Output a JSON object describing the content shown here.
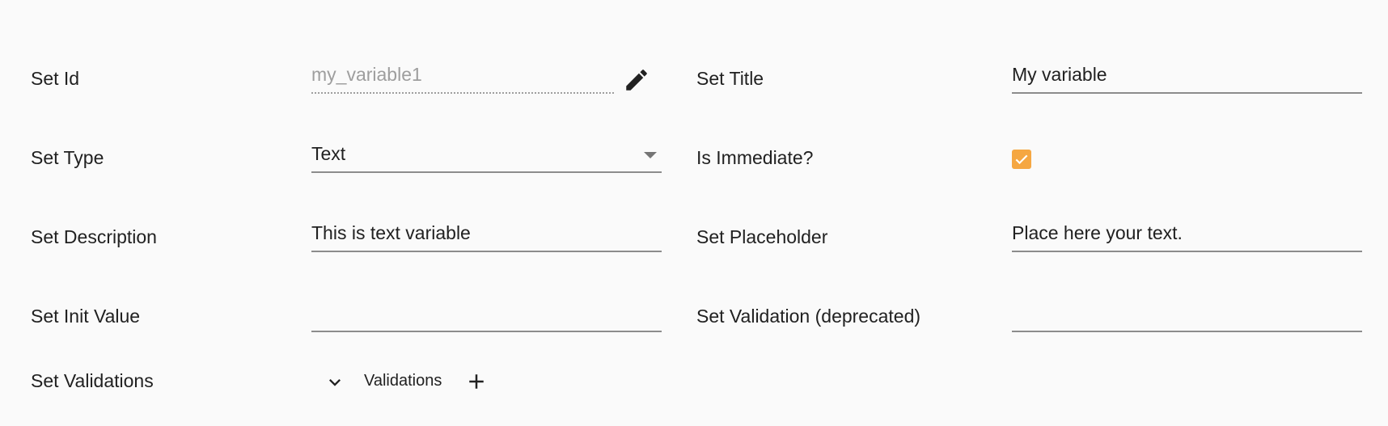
{
  "form": {
    "id": {
      "label": "Set Id",
      "value": "my_variable1"
    },
    "title": {
      "label": "Set Title",
      "value": "My variable"
    },
    "type": {
      "label": "Set Type",
      "value": "Text"
    },
    "immediate": {
      "label": "Is Immediate?",
      "checked": true
    },
    "description": {
      "label": "Set Description",
      "value": "This is text variable"
    },
    "placeholder": {
      "label": "Set Placeholder",
      "value": "Place here your text."
    },
    "init_value": {
      "label": "Set Init Value",
      "value": ""
    },
    "validation_deprecated": {
      "label": "Set Validation (deprecated)",
      "value": ""
    },
    "validations": {
      "label": "Set Validations",
      "section_label": "Validations"
    }
  },
  "icons": {
    "edit": "pencil-icon",
    "dropdown": "dropdown-arrow-icon",
    "expand": "chevron-down-icon",
    "add": "plus-icon",
    "check": "check-icon"
  },
  "colors": {
    "background": "#fafafa",
    "checkbox_accent": "#f5a742",
    "text": "#212121",
    "disabled_text": "#9e9e9e",
    "underline": "#8c8c8c"
  }
}
